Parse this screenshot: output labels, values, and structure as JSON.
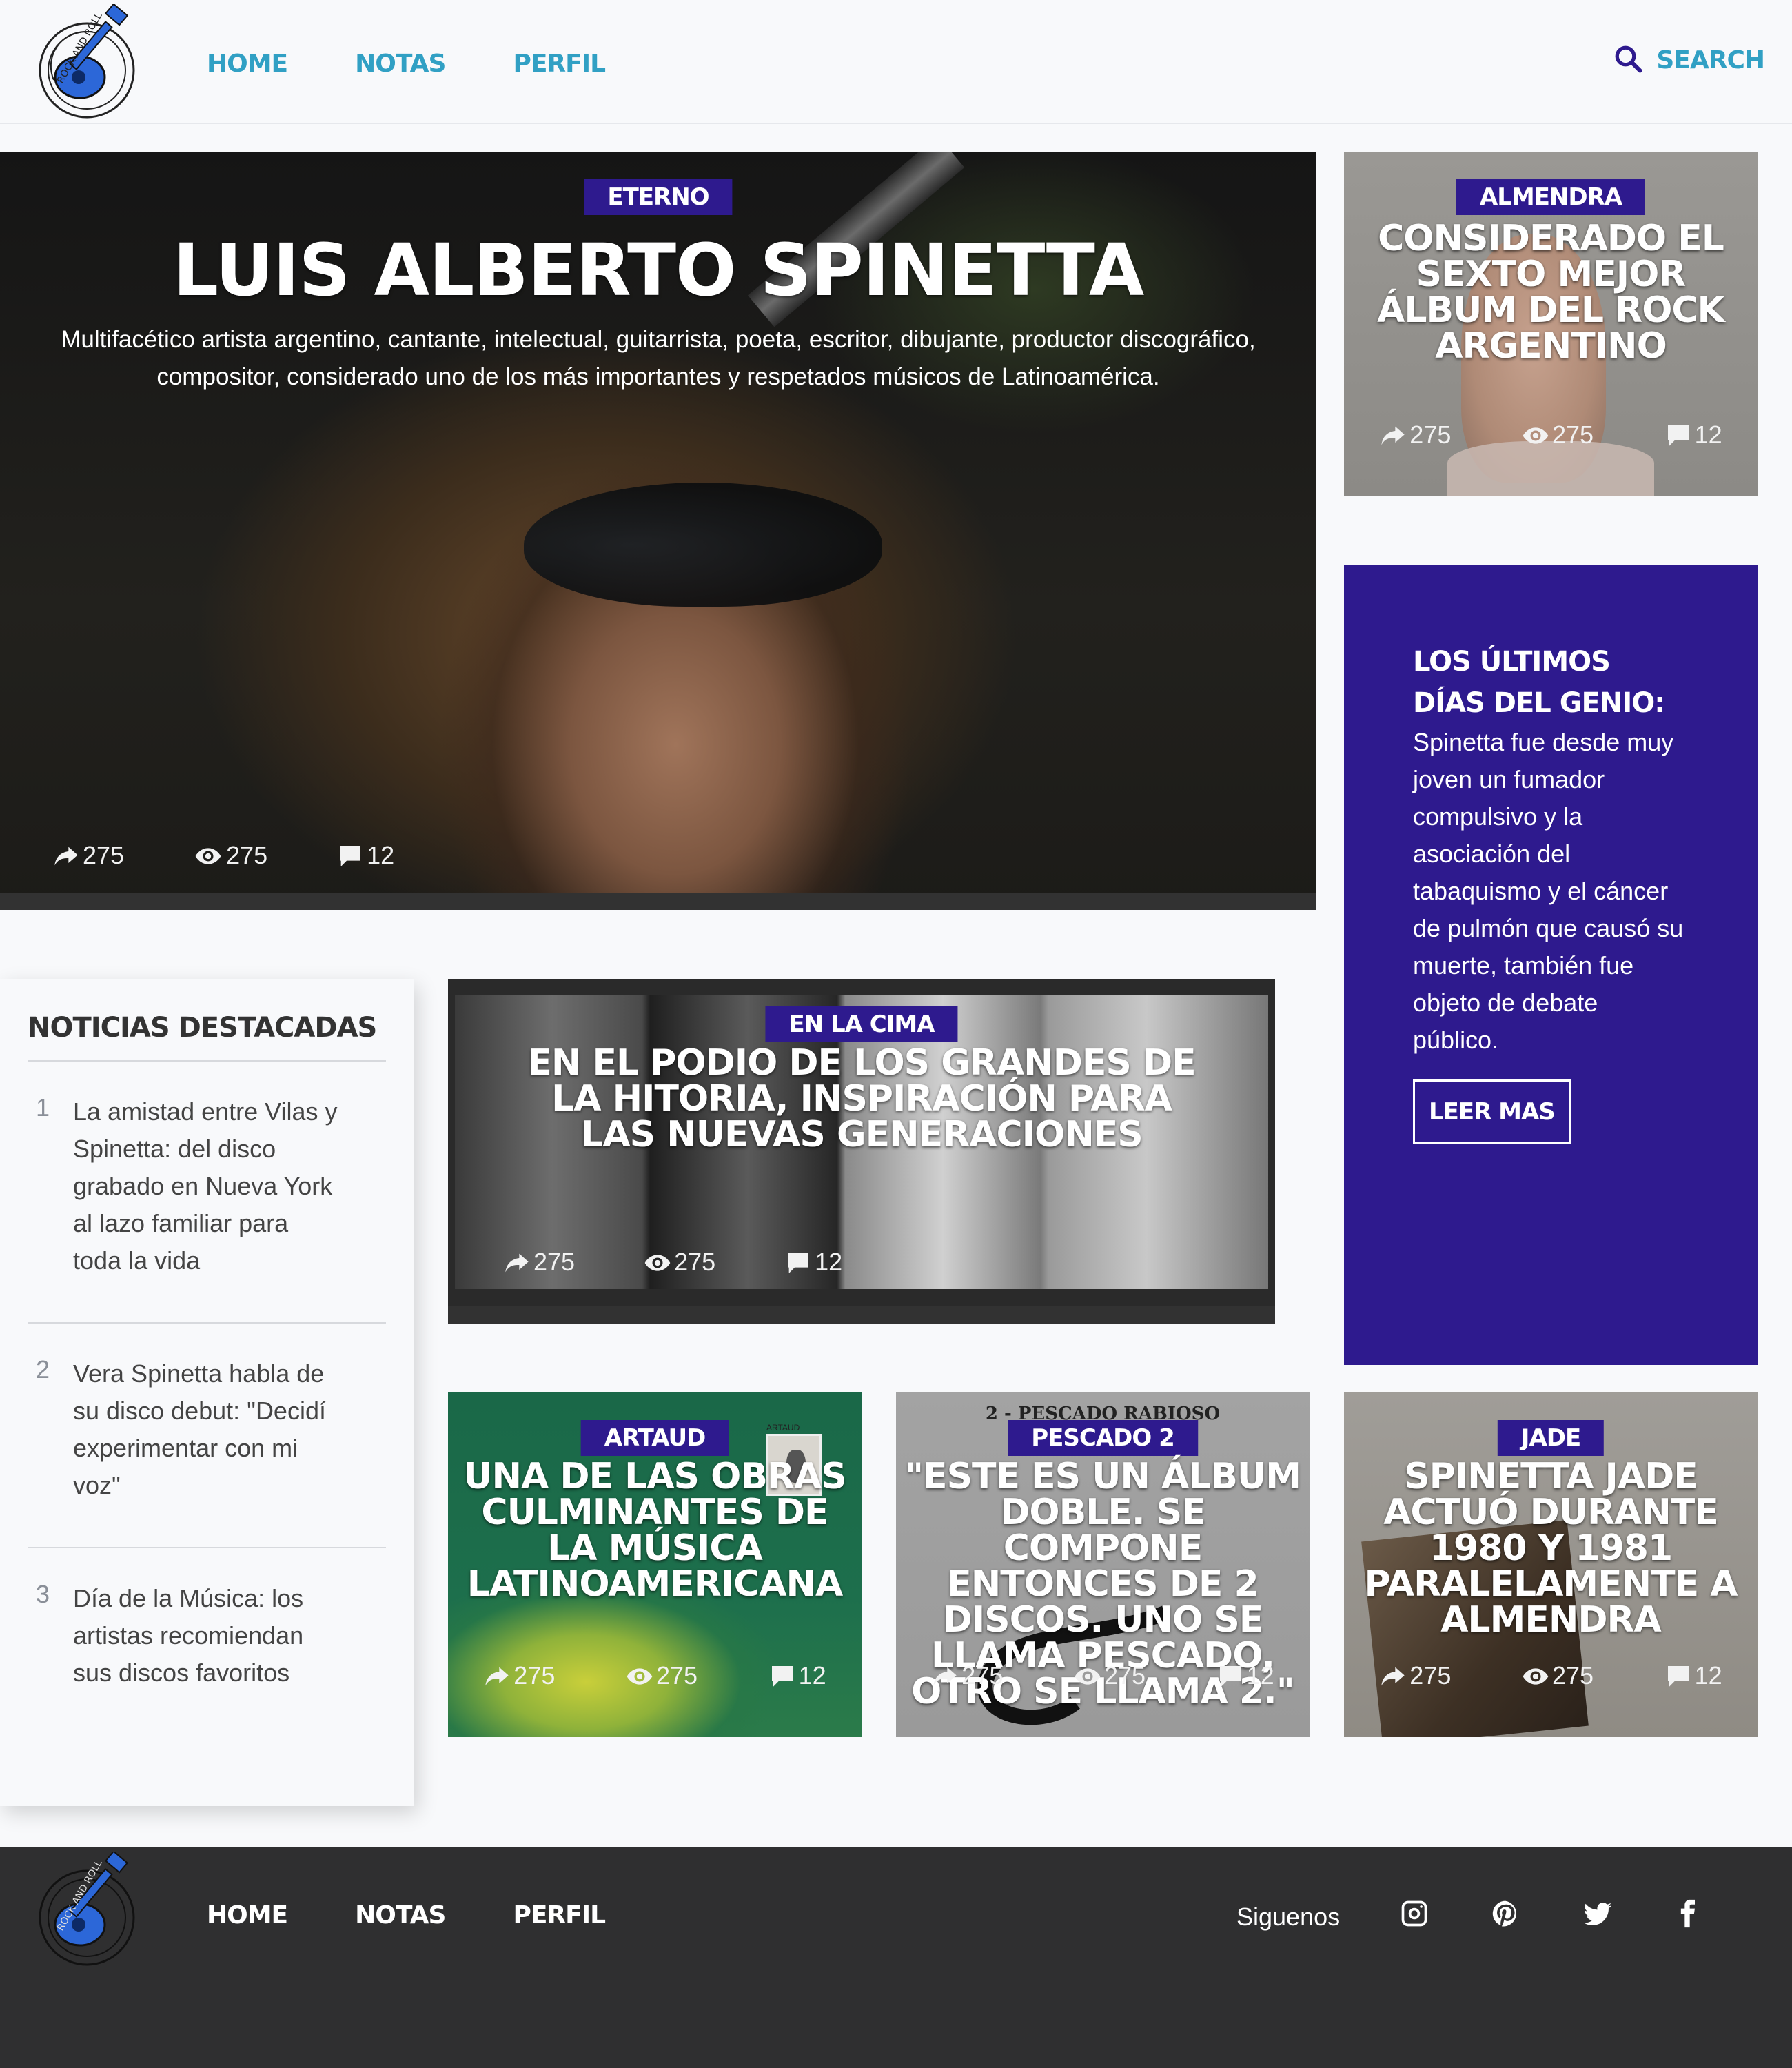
{
  "header": {
    "logo_text": "ROCK AND ROLL",
    "nav": [
      "HOME",
      "NOTAS",
      "PERFIL"
    ],
    "search_label": "SEARCH"
  },
  "hero": {
    "tag": "ETERNO",
    "title": "LUIS ALBERTO SPINETTA",
    "description": "Multifacético artista argentino, cantante, intelectual, guitarrista, poeta, escritor, dibujante, productor discográfico, compositor, considerado uno de los más importantes y respetados músicos de Latinoamérica.",
    "shares": "275",
    "views": "275",
    "comments": "12"
  },
  "cards": {
    "almendra": {
      "tag": "ALMENDRA",
      "title": "CONSIDERADO EL SEXTO MEJOR ÁLBUM DEL ROCK ARGENTINO",
      "shares": "275",
      "views": "275",
      "comments": "12"
    },
    "cima": {
      "tag": "EN LA CIMA",
      "title": "EN EL PODIO DE LOS GRANDES DE LA HITORIA, INSPIRACIÓN PARA LAS NUEVAS GENERACIONES",
      "shares": "275",
      "views": "275",
      "comments": "12"
    },
    "artaud": {
      "tag": "ARTAUD",
      "title": "UNA DE LAS OBRAS CULMINANTES DE LA MÚSICA LATINOAMERICANA",
      "shares": "275",
      "views": "275",
      "comments": "12",
      "cover_text": "ARTAUD"
    },
    "pescado": {
      "tag": "PESCADO 2",
      "title": "\"ESTE ES UN ÁLBUM DOBLE. SE COMPONE ENTONCES DE 2 DISCOS. UNO SE LLAMA PESCADO, OTRO SE LLAMA 2.\"",
      "shares": "275",
      "views": "275",
      "comments": "12",
      "cover_text": "2 - PESCADO RABIOSO"
    },
    "jade": {
      "tag": "JADE",
      "title": "SPINETTA JADE ACTUÓ DURANTE 1980 Y 1981 PARALELAMENTE A ALMENDRA",
      "shares": "275",
      "views": "275",
      "comments": "12"
    }
  },
  "promo": {
    "heading": "LOS ÚLTIMOS DÍAS DEL GENIO:",
    "body": "Spinetta fue desde muy joven un fumador compulsivo y la asociación del tabaquismo y el cáncer de pulmón que causó su muerte, también fue objeto de debate público.",
    "button": "LEER MAS"
  },
  "featured": {
    "title": "NOTICIAS DESTACADAS",
    "items": [
      {
        "num": "1",
        "text": "La amistad entre Vilas y Spinetta: del disco grabado en Nueva York al lazo familiar para toda la vida"
      },
      {
        "num": "2",
        "text": "Vera Spinetta habla de su disco debut: \"Decidí experimentar con mi voz\""
      },
      {
        "num": "3",
        "text": "Día de la Música: los artistas recomiendan sus discos favoritos"
      }
    ]
  },
  "footer": {
    "nav": [
      "HOME",
      "NOTAS",
      "PERFIL"
    ],
    "follow": "Siguenos",
    "social_icons": [
      "instagram-icon",
      "pinterest-icon",
      "twitter-icon",
      "facebook-icon"
    ]
  },
  "colors": {
    "accent": "#31a0c4",
    "brand_purple": "#2e1a8e",
    "footer_bg": "#2f2f30"
  }
}
